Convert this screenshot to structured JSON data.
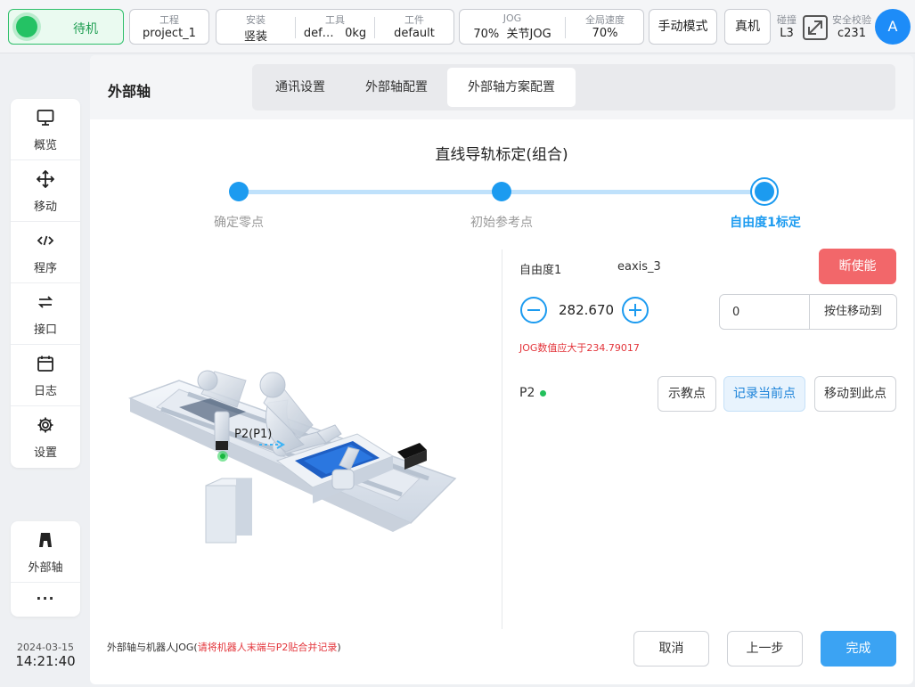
{
  "topbar": {
    "status": "待机",
    "project": {
      "label": "工程",
      "value": "project_1"
    },
    "install": {
      "label": "安装",
      "value": "竖装"
    },
    "tool": {
      "label": "工具",
      "value": "def…",
      "payload": "0kg"
    },
    "workpiece": {
      "label": "工件",
      "value": "default"
    },
    "jog": {
      "label": "JOG",
      "value": "70%",
      "mode": "关节JOG"
    },
    "global_speed": {
      "label": "全局速度",
      "value": "70%"
    },
    "manual_mode": "手动模式",
    "real_machine": "真机",
    "collision": {
      "label": "碰撞",
      "value": "L3"
    },
    "safety_check": {
      "label": "安全校验",
      "value": "c231"
    },
    "avatar": "A"
  },
  "sidebar": {
    "items": [
      {
        "label": "概览",
        "icon": "monitor-icon"
      },
      {
        "label": "移动",
        "icon": "move-icon"
      },
      {
        "label": "程序",
        "icon": "code-icon"
      },
      {
        "label": "接口",
        "icon": "interface-icon"
      },
      {
        "label": "日志",
        "icon": "calendar-icon"
      },
      {
        "label": "设置",
        "icon": "gear-icon"
      }
    ],
    "bottom_items": [
      {
        "label": "外部轴",
        "icon": "external-axis-icon"
      },
      {
        "label": "···",
        "icon": "more-icon"
      }
    ],
    "date": "2024-03-15",
    "time": "14:21:40"
  },
  "main": {
    "title": "外部轴",
    "tabs": [
      {
        "label": "通讯设置",
        "active": false
      },
      {
        "label": "外部轴配置",
        "active": false
      },
      {
        "label": "外部轴方案配置",
        "active": true
      }
    ],
    "wizard_title": "直线导轨标定(组合)",
    "steps": [
      {
        "label": "确定零点",
        "state": "done"
      },
      {
        "label": "初始参考点",
        "state": "done"
      },
      {
        "label": "自由度1标定",
        "state": "current"
      }
    ],
    "illustration_label": "P2(P1)",
    "dof": {
      "label": "自由度1",
      "axis": "eaxis_3",
      "disable_button": "断使能"
    },
    "jog_value": "282.670",
    "move_input": {
      "value": "0",
      "button": "按住移动到"
    },
    "warning": "JOG数值应大于234.79017",
    "point": {
      "label": "P2",
      "status_color": "#23c05c"
    },
    "point_buttons": {
      "teach": "示教点",
      "record": "记录当前点",
      "move_to": "移动到此点"
    },
    "footer_note": {
      "prefix": "外部轴与机器人JOG(",
      "highlight": "请将机器人末端与P2贴合并记录",
      "suffix": ")"
    },
    "footer_buttons": {
      "cancel": "取消",
      "prev": "上一步",
      "finish": "完成"
    }
  },
  "colors": {
    "accent": "#1c9bf0",
    "danger": "#f2676a",
    "success": "#23c05c",
    "primary_button": "#3ba3f3"
  }
}
